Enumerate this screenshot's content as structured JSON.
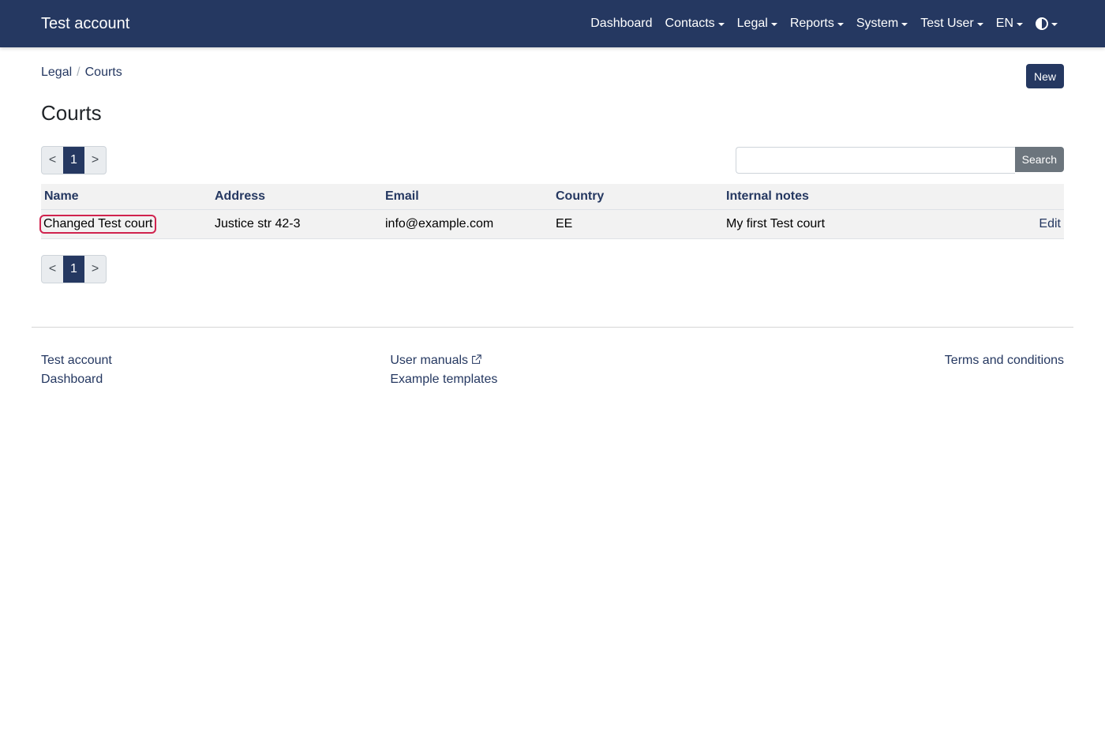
{
  "navbar": {
    "brand": "Test account",
    "items": [
      {
        "label": "Dashboard",
        "dropdown": false
      },
      {
        "label": "Contacts",
        "dropdown": true
      },
      {
        "label": "Legal",
        "dropdown": true
      },
      {
        "label": "Reports",
        "dropdown": true
      },
      {
        "label": "System",
        "dropdown": true
      },
      {
        "label": "Test User",
        "dropdown": true
      },
      {
        "label": "EN",
        "dropdown": true
      }
    ],
    "theme_icon": "contrast-icon"
  },
  "breadcrumb": {
    "items": [
      "Legal",
      "Courts"
    ]
  },
  "header": {
    "new_label": "New",
    "title": "Courts"
  },
  "pagination": {
    "prev": "<",
    "current": "1",
    "next": ">"
  },
  "search": {
    "value": "",
    "placeholder": "",
    "button_label": "Search"
  },
  "table": {
    "columns": [
      "Name",
      "Address",
      "Email",
      "Country",
      "Internal notes"
    ],
    "rows": [
      {
        "name": "Changed Test court",
        "address": "Justice str 42-3",
        "email": "info@example.com",
        "country": "EE",
        "notes": "My first Test court",
        "action": "Edit"
      }
    ]
  },
  "footer": {
    "left": [
      "Test account",
      "Dashboard"
    ],
    "middle": [
      "User manuals",
      "Example templates"
    ],
    "right": [
      "Terms and conditions"
    ],
    "external_icon": "external-link-icon"
  },
  "colors": {
    "navbar": "#253861",
    "highlight_border": "#d0234e",
    "search_button": "#6c757d"
  }
}
